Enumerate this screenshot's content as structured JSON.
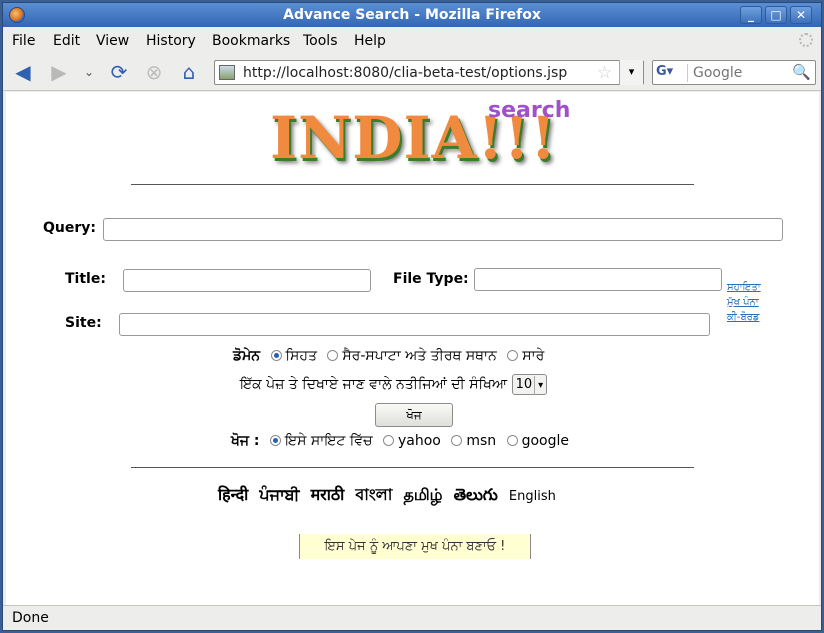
{
  "window": {
    "title": "Advance Search - Mozilla Firefox"
  },
  "menu": [
    "File",
    "Edit",
    "View",
    "History",
    "Bookmarks",
    "Tools",
    "Help"
  ],
  "toolbar": {
    "url": "http://localhost:8080/clia-beta-test/options.jsp",
    "search_engine": "G",
    "search_placeholder": "Google"
  },
  "logo": {
    "main": "INDIA!!!",
    "sub": "search"
  },
  "form": {
    "query_label": "Query:",
    "title_label": "Title:",
    "filetype_label": "File Type:",
    "site_label": "Site:",
    "domain_label": "ਡੋਮੇਨ",
    "domain_options": [
      "ਸਿਹਤ",
      "ਸੈਰ-ਸਪਾਟਾ ਅਤੇ ਤੀਰਥ ਸਥਾਨ",
      "ਸਾਰੇ"
    ],
    "results_label": "ਇੱਕ ਪੇਜ਼ ਤੇ ਦਿਖਾਏ ਜਾਣ ਵਾਲੇ ਨਤੀਜਿਆਂ ਦੀ ਸੰਖਿਆ",
    "results_value": "10",
    "search_button": "ਖੋਜ",
    "search_in_label": "ਖੋਜ :",
    "search_in_options": [
      "ਇਸੇ ਸਾਇਟ ਵਿੱਚ",
      "yahoo",
      "msn",
      "google"
    ]
  },
  "side_links": [
    "ਸਹਾਇਤਾ",
    "ਮੁੱਖ ਪੰਨਾ",
    "ਕੀ-ਬੋਰਡ"
  ],
  "languages": [
    "हिन्दी",
    "ਪੰਜਾਬੀ",
    "मराठी",
    "বাংলা",
    "தமிழ்",
    "తెలుగు",
    "English"
  ],
  "homepage_text": "ਇਸ ਪੇਜ ਨੂੰ ਆਪਣਾ ਮੁਖ ਪੰਨਾ ਬਣਾਓ !",
  "status": "Done"
}
